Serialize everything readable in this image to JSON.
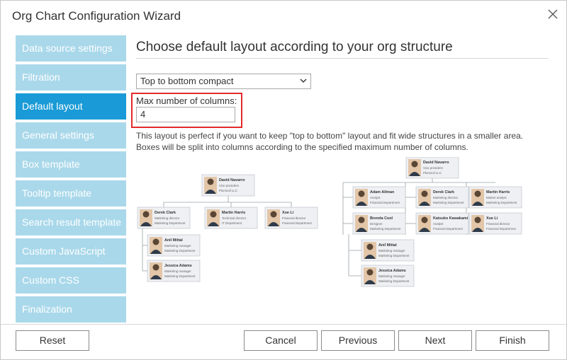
{
  "window": {
    "title": "Org Chart Configuration Wizard"
  },
  "sidebar": {
    "items": [
      {
        "label": "Data source settings"
      },
      {
        "label": "Filtration"
      },
      {
        "label": "Default layout"
      },
      {
        "label": "General settings"
      },
      {
        "label": "Box template"
      },
      {
        "label": "Tooltip template"
      },
      {
        "label": "Search result template"
      },
      {
        "label": "Custom JavaScript"
      },
      {
        "label": "Custom CSS"
      },
      {
        "label": "Finalization"
      }
    ],
    "active_index": 2
  },
  "main": {
    "heading": "Choose default layout according to your org structure",
    "layout_select": {
      "value": "Top to bottom compact"
    },
    "max_columns": {
      "label": "Max number of columns:",
      "value": "4"
    },
    "description_line1": "This layout is perfect if you want to keep \"top to bottom\" layout and fit wide structures in a smaller area.",
    "description_line2": "Boxes will be split into columns according to the specified maximum number of columns."
  },
  "diagram_left": {
    "root": {
      "name": "David Navarro",
      "title": "Vice president",
      "dept": "Plumsoil LLC"
    },
    "children": [
      {
        "name": "Derek Clark",
        "title": "Marketing director",
        "dept": "Marketing Department"
      },
      {
        "name": "Martin Harris",
        "title": "Technical director",
        "dept": "IT Department"
      },
      {
        "name": "Xue Li",
        "title": "Financial director",
        "dept": "Financial Department"
      }
    ],
    "sub": [
      {
        "name": "Anil Mittal",
        "title": "Marketing manager",
        "dept": "Marketing Department"
      },
      {
        "name": "Jessica Adams",
        "title": "Marketing manager",
        "dept": "Marketing Department"
      }
    ]
  },
  "diagram_right": {
    "root": {
      "name": "David Navarro",
      "title": "Vice president",
      "dept": "Plumsoil LLC"
    },
    "row1": [
      {
        "name": "Adam Allman",
        "title": "Analyst",
        "dept": "Financial Department"
      },
      {
        "name": "Derek Clark",
        "title": "Marketing director",
        "dept": "Marketing Department"
      },
      {
        "name": "Martin Harris",
        "title": "Market analyst",
        "dept": "Marketing Department"
      }
    ],
    "row2": [
      {
        "name": "Brenda Cool",
        "title": "Designer",
        "dept": "Marketing Department"
      },
      {
        "name": "Katsuko Kawakami",
        "title": "Analyst",
        "dept": "Financial Department"
      },
      {
        "name": "Xue Li",
        "title": "Financial director",
        "dept": "Financial Department"
      }
    ],
    "sub": [
      {
        "name": "Anil Mittal",
        "title": "Marketing manager",
        "dept": "Marketing Department"
      },
      {
        "name": "Jessica Adams",
        "title": "Marketing manager",
        "dept": "Marketing Department"
      }
    ]
  },
  "footer": {
    "reset": "Reset",
    "cancel": "Cancel",
    "previous": "Previous",
    "next": "Next",
    "finish": "Finish"
  },
  "colors": {
    "nav_bg": "#a9d8ea",
    "nav_active": "#1a9ad6",
    "highlight_border": "#e22b2b"
  }
}
